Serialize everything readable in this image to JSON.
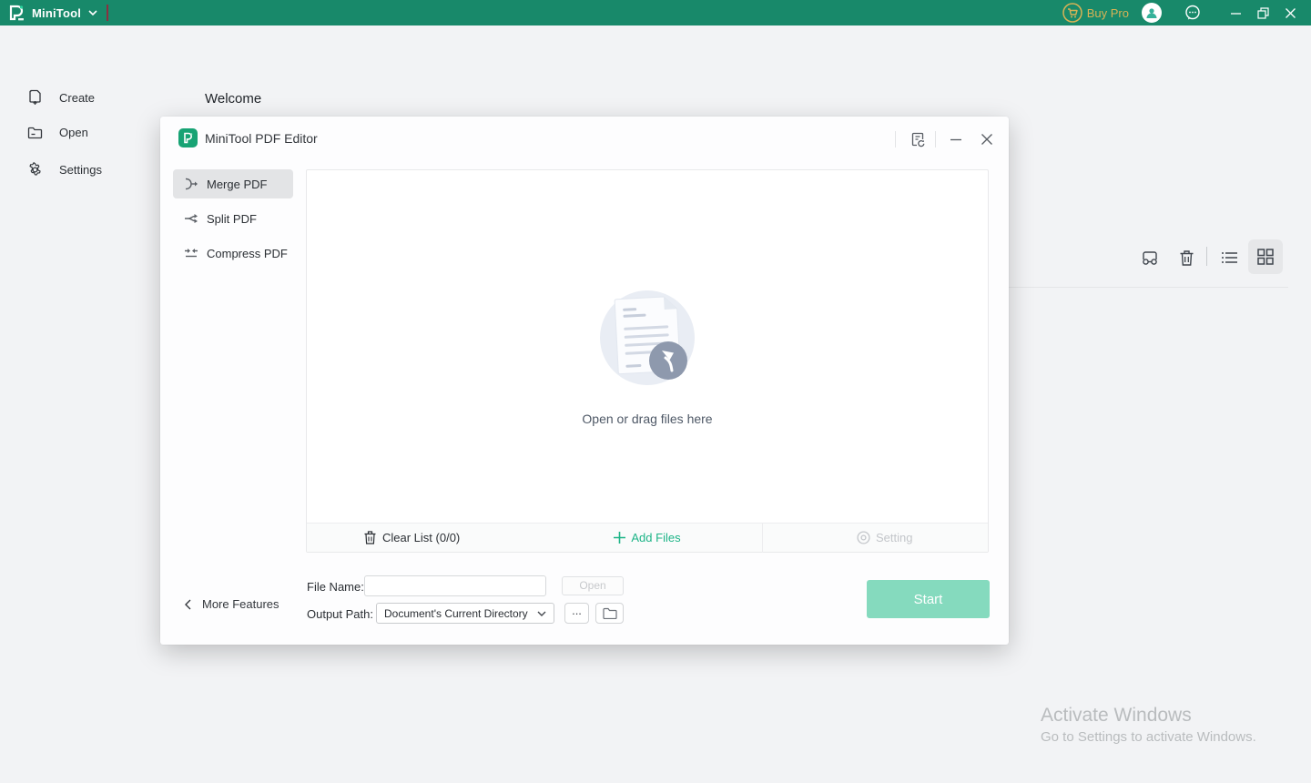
{
  "titlebar": {
    "brand": "MiniTool",
    "buy_pro_label": "Buy Pro",
    "icons": [
      "pdf-logo-icon",
      "dropdown-caret-icon",
      "cart-icon",
      "avatar",
      "chat-icon",
      "minimize-icon",
      "restore-icon",
      "close-icon"
    ]
  },
  "colors": {
    "titlebar_green": "#18896a",
    "accent_green": "#1db487",
    "gold": "#d8b355",
    "start_button": "#85dabe",
    "selected_tab_bg": "#e3e4e6"
  },
  "sidebar": {
    "items": [
      {
        "label": "Create",
        "icon": "new-document-icon"
      },
      {
        "label": "Open",
        "icon": "open-folder-icon"
      },
      {
        "label": "Settings",
        "icon": "gear-icon"
      }
    ]
  },
  "main": {
    "tab_label": "Welcome",
    "toolbar_icons": [
      "glasses-icon",
      "trash-icon",
      "list-view-icon",
      "grid-view-icon"
    ],
    "view_mode": "grid"
  },
  "dialog": {
    "title": "MiniTool PDF Editor",
    "header_icons": [
      "feedback-icon",
      "minimize-icon",
      "close-icon"
    ],
    "tabs": [
      {
        "label": "Merge PDF",
        "icon": "merge-icon",
        "selected": true
      },
      {
        "label": "Split PDF",
        "icon": "split-icon",
        "selected": false
      },
      {
        "label": "Compress PDF",
        "icon": "compress-icon",
        "selected": false
      }
    ],
    "dropzone": {
      "hint": "Open or drag files here",
      "illustration": "document-with-cursor"
    },
    "footer": {
      "clear_list_label": "Clear List (0/0)",
      "add_files_label": "Add Files",
      "setting_label": "Setting"
    },
    "form": {
      "file_name_label": "File Name:",
      "file_name_value": "",
      "open_label": "Open",
      "output_path_label": "Output Path:",
      "output_path_value": "Document's Current Directory",
      "browse_label": "...",
      "start_label": "Start",
      "more_features_label": "More Features"
    }
  },
  "watermark": {
    "line1": "Activate Windows",
    "line2": "Go to Settings to activate Windows."
  }
}
